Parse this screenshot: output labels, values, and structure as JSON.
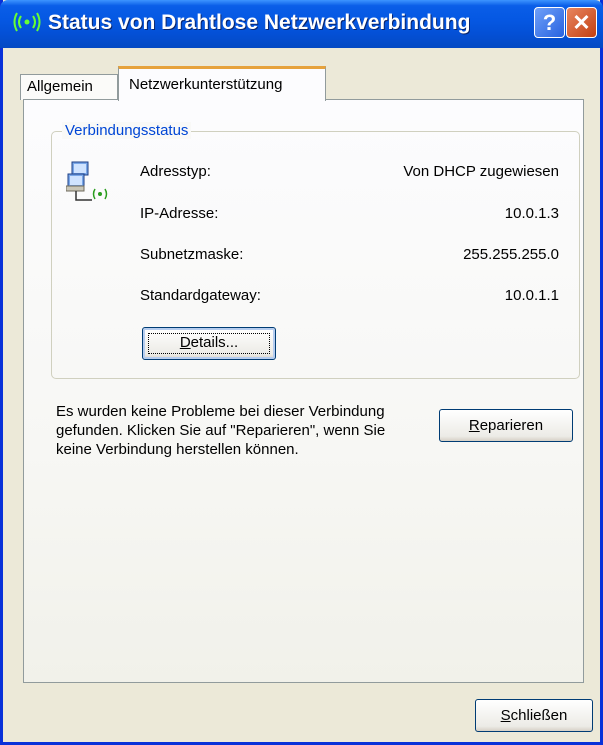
{
  "window": {
    "title": "Status von Drahtlose Netzwerkverbindung",
    "help_label": "?",
    "close_label": "✕"
  },
  "tabs": [
    {
      "label": "Allgemein"
    },
    {
      "label": "Netzwerkunterstützung"
    }
  ],
  "status_group": {
    "title": "Verbindungsstatus",
    "rows": [
      {
        "label": "Adresstyp:",
        "value": "Von DHCP zugewiesen"
      },
      {
        "label": "IP-Adresse:",
        "value": "10.0.1.3"
      },
      {
        "label": "Subnetzmaske:",
        "value": "255.255.255.0"
      },
      {
        "label": "Standardgateway:",
        "value": "10.0.1.1"
      }
    ],
    "details_button": {
      "underlined": "D",
      "rest": "etails..."
    }
  },
  "message": "Es wurden keine Probleme bei dieser Verbindung gefunden. Klicken Sie auf \"Reparieren\", wenn Sie keine Verbindung herstellen können.",
  "repair_button": {
    "underlined": "R",
    "rest": "eparieren"
  },
  "close_button": {
    "underlined": "S",
    "rest": "chließen"
  }
}
